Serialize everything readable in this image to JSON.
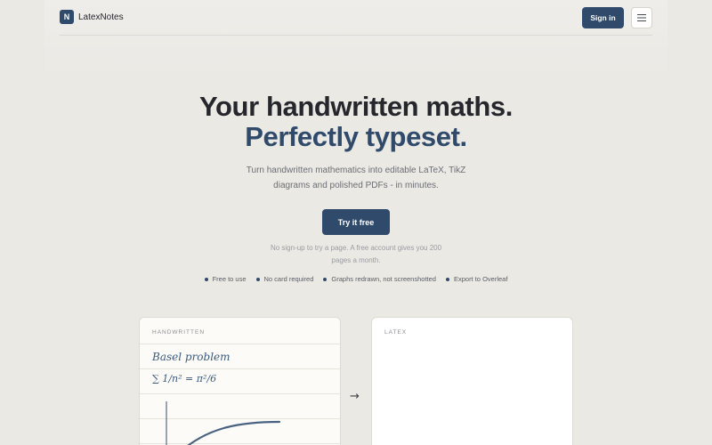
{
  "nav": {
    "logo_letter": "N",
    "brand": "LatexNotes",
    "sign_in": "Sign in",
    "menu_icon": "hamburger-menu-icon"
  },
  "hero": {
    "title_line1": "Your handwritten maths.",
    "title_line2": "Perfectly typeset.",
    "subtitle_line1": "Turn handwritten mathematics into editable LaTeX, TikZ",
    "subtitle_line2": "diagrams and polished PDFs - in minutes.",
    "cta": "Try it free",
    "note_line1": "No sign-up to try a page. A free account gives you 200",
    "note_line2": "pages a month."
  },
  "features": [
    "Free to use",
    "No card required",
    "Graphs redrawn, not screenshotted",
    "Export to Overleaf"
  ],
  "demo": {
    "handwritten_label": "HANDWRITTEN",
    "latex_label": "LATEX",
    "hand_line1": "Basel problem",
    "hand_line2": "∑ 1/n² = π²/6",
    "arrow_icon": "right-arrow-icon"
  },
  "colors": {
    "accent": "#2f4a6b",
    "background": "#ebe9e4",
    "ink": "#3b5a80"
  }
}
